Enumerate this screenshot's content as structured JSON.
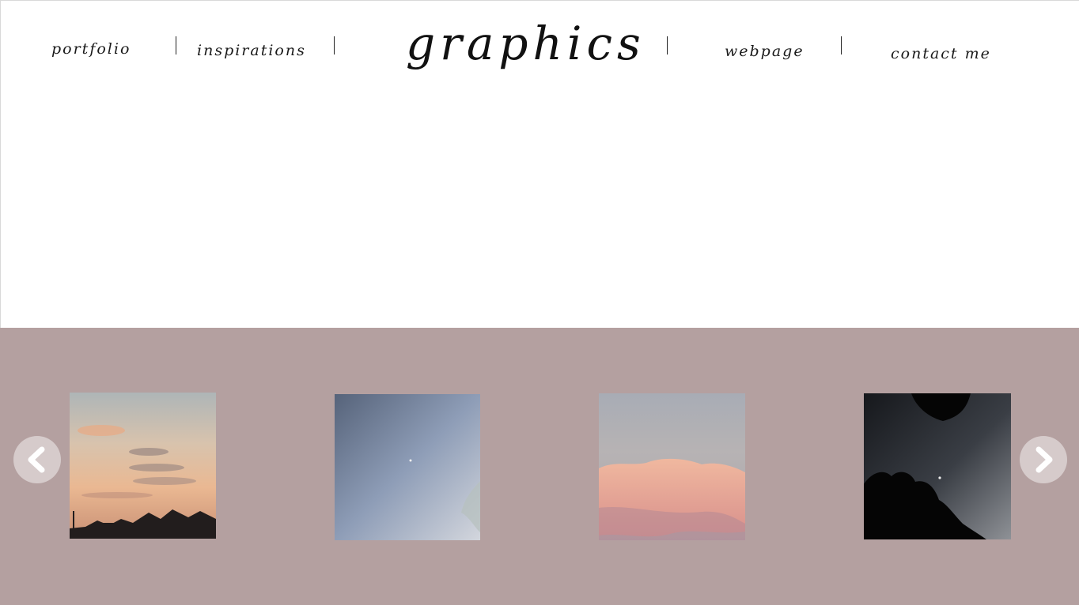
{
  "header": {
    "logo": "graphics",
    "nav": [
      {
        "label": "portfolio"
      },
      {
        "label": "inspirations"
      },
      {
        "label": "webpage"
      },
      {
        "label": "contact me"
      }
    ]
  },
  "carousel": {
    "photos": [
      {
        "name": "sunset-clouds-photo"
      },
      {
        "name": "blue-sky-moon-photo"
      },
      {
        "name": "pink-cloud-photo"
      },
      {
        "name": "night-trees-moon-photo"
      }
    ],
    "prev_icon": "chevron-left-icon",
    "next_icon": "chevron-right-icon"
  },
  "colors": {
    "carousel_bg": "#b4a0a0",
    "text": "#1a1a1a"
  }
}
